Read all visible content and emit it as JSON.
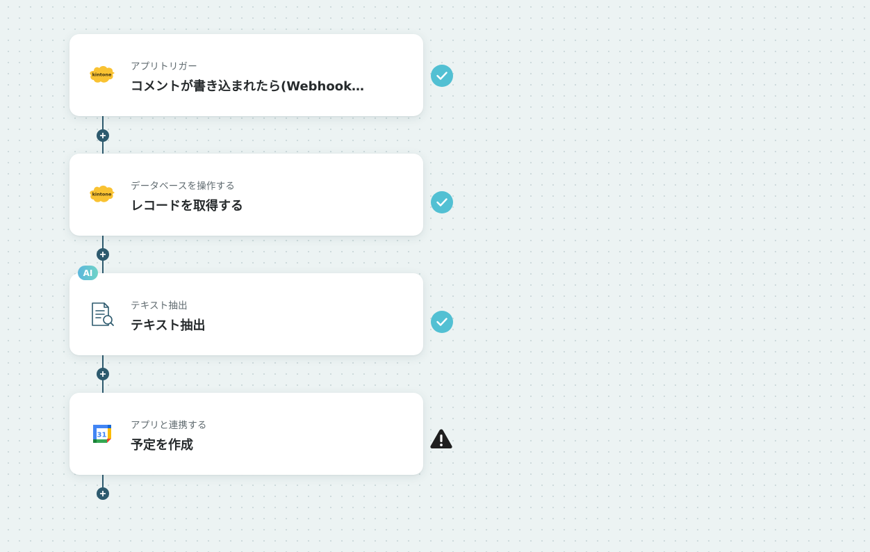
{
  "flow": {
    "steps": [
      {
        "subtitle": "アプリトリガー",
        "title": "コメントが書き込まれたら(Webhook…",
        "icon": "kintone-logo-icon",
        "logo_text": "kintone",
        "status": "success",
        "ai": false
      },
      {
        "subtitle": "データベースを操作する",
        "title": "レコードを取得する",
        "icon": "kintone-logo-icon",
        "logo_text": "kintone",
        "status": "success",
        "ai": false
      },
      {
        "subtitle": "テキスト抽出",
        "title": "テキスト抽出",
        "icon": "document-search-icon",
        "status": "success",
        "ai": true,
        "badge": "AI"
      },
      {
        "subtitle": "アプリと連携する",
        "title": "予定を作成",
        "icon": "google-calendar-icon",
        "calendar_day": "31",
        "status": "warning",
        "ai": false
      }
    ]
  },
  "colors": {
    "background": "#ecf3f3",
    "connector": "#2d5a6e",
    "success": "#52c0d3",
    "warning": "#1f1f1f",
    "kintone_yellow": "#f9c232"
  }
}
